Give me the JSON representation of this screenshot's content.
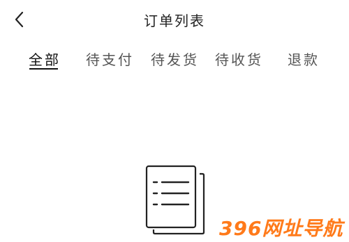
{
  "header": {
    "title": "订单列表",
    "back_icon": "chevron-left-icon"
  },
  "tabs": [
    {
      "label": "全部",
      "active": true
    },
    {
      "label": "待支付",
      "active": false
    },
    {
      "label": "待发货",
      "active": false
    },
    {
      "label": "待收货",
      "active": false
    },
    {
      "label": "退款",
      "active": false
    }
  ],
  "empty_state": {
    "icon": "document-list-icon"
  },
  "watermark": {
    "text": "396网址导航",
    "color": "#ff7a1a"
  }
}
